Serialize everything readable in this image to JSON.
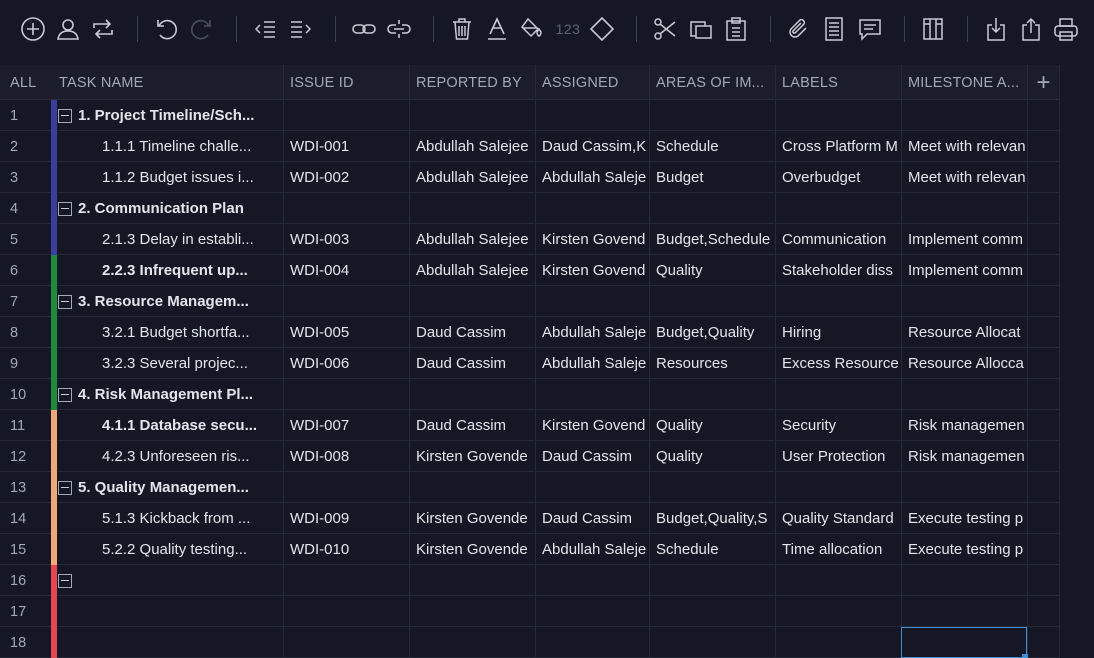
{
  "colors": {
    "background": "#151824",
    "header_bg": "#1b1e2a",
    "strip_blue": "#3a3f9e",
    "strip_green": "#1f8a3e",
    "strip_orange": "#f2a876",
    "strip_red": "#e64553",
    "selection": "#3e8ed8"
  },
  "toolbar": {
    "icons": [
      "add-circle-icon",
      "user-icon",
      "swap-icon",
      "undo-icon",
      "redo-icon",
      "outdent-icon",
      "indent-icon",
      "link-icon",
      "unlink-icon",
      "trash-icon",
      "text-color-icon",
      "fill-color-icon",
      "number-format-icon",
      "milestone-diamond-icon",
      "cut-icon",
      "copy-icon",
      "paste-icon",
      "attachment-icon",
      "notes-icon",
      "comment-icon",
      "columns-icon",
      "import-icon",
      "export-icon",
      "print-icon"
    ],
    "number_format_label": "123"
  },
  "columns": {
    "all": "ALL",
    "task_name": "TASK NAME",
    "issue_id": "ISSUE ID",
    "reported_by": "REPORTED BY",
    "assigned": "ASSIGNED",
    "areas": "AREAS OF IM...",
    "labels": "LABELS",
    "milestone": "MILESTONE A...",
    "add": "+"
  },
  "rows": [
    {
      "num": "1",
      "type": "group",
      "strip": "strip_blue",
      "task": "1. Project Timeline/Sch...",
      "issue": "",
      "reported": "",
      "assigned": "",
      "areas": "",
      "labels": "",
      "milestone": ""
    },
    {
      "num": "2",
      "type": "child",
      "strip": "strip_blue",
      "task": "1.1.1 Timeline challe...",
      "issue": "WDI-001",
      "reported": "Abdullah Salejee",
      "assigned": "Daud Cassim,K",
      "areas": "Schedule",
      "labels": "Cross Platform M",
      "milestone": "Meet with relevan"
    },
    {
      "num": "3",
      "type": "child",
      "strip": "strip_blue",
      "task": "1.1.2 Budget issues i...",
      "issue": "WDI-002",
      "reported": "Abdullah Salejee",
      "assigned": "Abdullah Saleje",
      "areas": "Budget",
      "labels": "Overbudget",
      "milestone": "Meet with relevan"
    },
    {
      "num": "4",
      "type": "group",
      "strip": "strip_blue",
      "task": "2. Communication Plan",
      "issue": "",
      "reported": "",
      "assigned": "",
      "areas": "",
      "labels": "",
      "milestone": ""
    },
    {
      "num": "5",
      "type": "child",
      "strip": "strip_blue",
      "task": "2.1.3 Delay in establi...",
      "issue": "WDI-003",
      "reported": "Abdullah Salejee",
      "assigned": "Kirsten Govend",
      "areas": "Budget,Schedule",
      "labels": "Communication",
      "milestone": "Implement comm"
    },
    {
      "num": "6",
      "type": "child-bold",
      "strip": "strip_green",
      "task": "2.2.3 Infrequent up...",
      "issue": "WDI-004",
      "reported": "Abdullah Salejee",
      "assigned": "Kirsten Govend",
      "areas": "Quality",
      "labels": "Stakeholder diss",
      "milestone": "Implement comm"
    },
    {
      "num": "7",
      "type": "group",
      "strip": "strip_green",
      "task": "3. Resource Managem...",
      "issue": "",
      "reported": "",
      "assigned": "",
      "areas": "",
      "labels": "",
      "milestone": ""
    },
    {
      "num": "8",
      "type": "child",
      "strip": "strip_green",
      "task": "3.2.1 Budget shortfa...",
      "issue": "WDI-005",
      "reported": "Daud Cassim",
      "assigned": "Abdullah Saleje",
      "areas": "Budget,Quality",
      "labels": "Hiring",
      "milestone": "Resource Allocat"
    },
    {
      "num": "9",
      "type": "child",
      "strip": "strip_green",
      "task": "3.2.3 Several projec...",
      "issue": "WDI-006",
      "reported": "Daud Cassim",
      "assigned": "Abdullah Saleje",
      "areas": "Resources",
      "labels": "Excess Resource",
      "milestone": "Resource Allocca"
    },
    {
      "num": "10",
      "type": "group",
      "strip": "strip_green",
      "task": "4. Risk Management Pl...",
      "issue": "",
      "reported": "",
      "assigned": "",
      "areas": "",
      "labels": "",
      "milestone": ""
    },
    {
      "num": "11",
      "type": "child-bold",
      "strip": "strip_orange",
      "task": "4.1.1 Database secu...",
      "issue": "WDI-007",
      "reported": "Daud Cassim",
      "assigned": "Kirsten Govend",
      "areas": "Quality",
      "labels": "Security",
      "milestone": "Risk managemen"
    },
    {
      "num": "12",
      "type": "child",
      "strip": "strip_orange",
      "task": "4.2.3 Unforeseen ris...",
      "issue": "WDI-008",
      "reported": "Kirsten Govende",
      "assigned": "Daud Cassim",
      "areas": "Quality",
      "labels": "User Protection",
      "milestone": "Risk managemen"
    },
    {
      "num": "13",
      "type": "group",
      "strip": "strip_orange",
      "task": "5. Quality Managemen...",
      "issue": "",
      "reported": "",
      "assigned": "",
      "areas": "",
      "labels": "",
      "milestone": ""
    },
    {
      "num": "14",
      "type": "child",
      "strip": "strip_orange",
      "task": "5.1.3 Kickback from ...",
      "issue": "WDI-009",
      "reported": "Kirsten Govende",
      "assigned": "Daud Cassim",
      "areas": "Budget,Quality,S",
      "labels": "Quality Standard",
      "milestone": "Execute testing p"
    },
    {
      "num": "15",
      "type": "child",
      "strip": "strip_orange",
      "task": "5.2.2 Quality testing...",
      "issue": "WDI-010",
      "reported": "Kirsten Govende",
      "assigned": "Abdullah Saleje",
      "areas": "Schedule",
      "labels": "Time allocation",
      "milestone": "Execute testing p"
    },
    {
      "num": "16",
      "type": "group",
      "strip": "strip_red",
      "task": "",
      "issue": "",
      "reported": "",
      "assigned": "",
      "areas": "",
      "labels": "",
      "milestone": ""
    },
    {
      "num": "17",
      "type": "empty",
      "strip": "strip_red",
      "task": "",
      "issue": "",
      "reported": "",
      "assigned": "",
      "areas": "",
      "labels": "",
      "milestone": ""
    },
    {
      "num": "18",
      "type": "empty",
      "strip": "strip_red",
      "task": "",
      "issue": "",
      "reported": "",
      "assigned": "",
      "areas": "",
      "labels": "",
      "milestone": ""
    }
  ]
}
